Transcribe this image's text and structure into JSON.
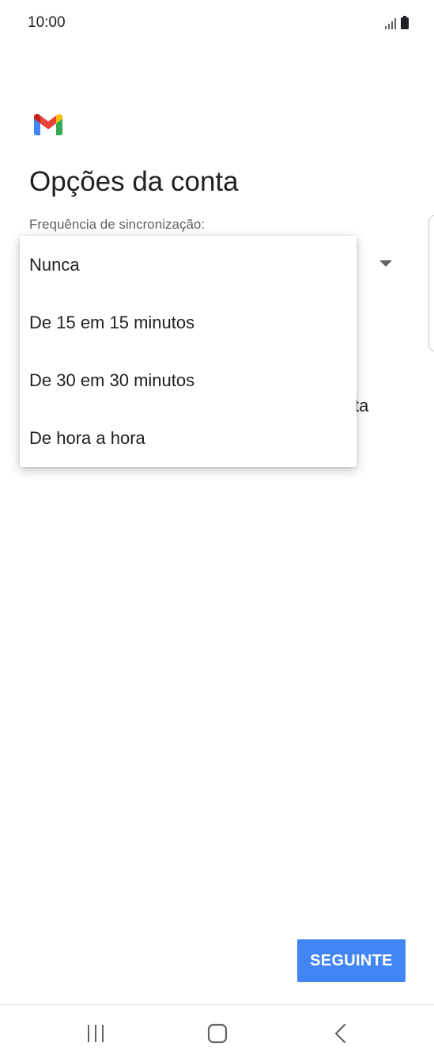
{
  "status_bar": {
    "time": "10:00",
    "icons": [
      "signal-icon",
      "battery-icon"
    ]
  },
  "app": {
    "logo": "gmail-logo",
    "title": "Opções da conta"
  },
  "sync_field": {
    "label": "Frequência de sincronização:",
    "icon": "dropdown-arrow-icon"
  },
  "background_text_fragment": "ta",
  "dropdown": {
    "options": [
      "Nunca",
      "De 15 em 15 minutos",
      "De 30 em 30 minutos",
      "De hora a hora"
    ]
  },
  "footer": {
    "next_label": "SEGUINTE",
    "next_color": "#4285f4"
  },
  "nav_bar": {
    "icons": [
      "recents-icon",
      "home-icon",
      "back-icon"
    ]
  }
}
